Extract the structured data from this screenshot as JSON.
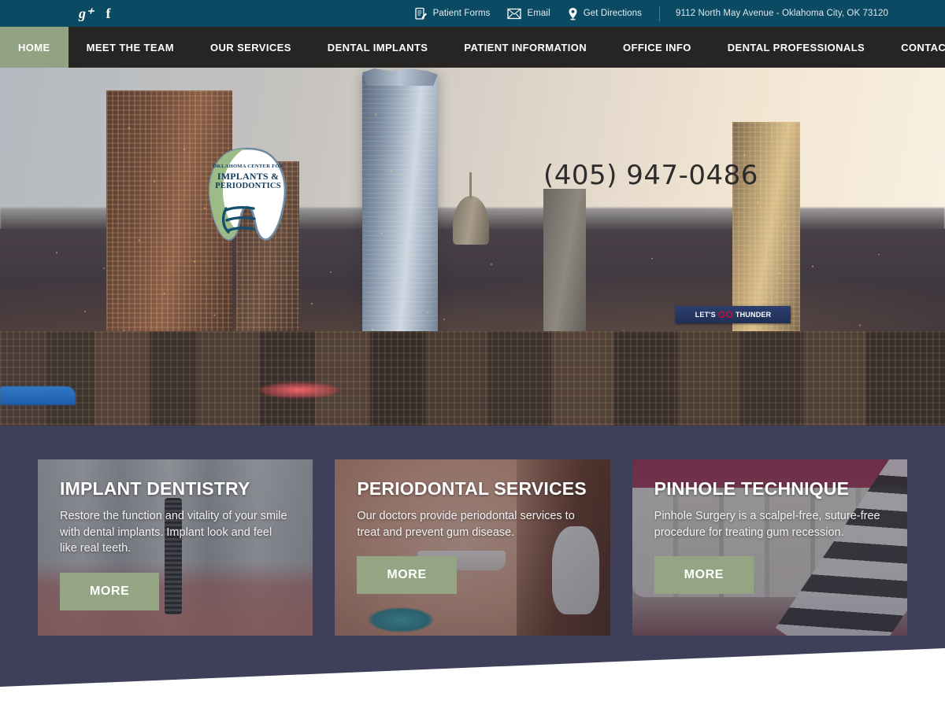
{
  "topbar": {
    "social": [
      {
        "name": "google-plus-icon",
        "glyph": "g⁺"
      },
      {
        "name": "facebook-icon",
        "glyph": "f"
      }
    ],
    "links": [
      {
        "label": "Patient Forms",
        "icon": "patient-forms-icon"
      },
      {
        "label": "Email",
        "icon": "envelope-icon"
      },
      {
        "label": "Get Directions",
        "icon": "map-pin-icon"
      }
    ],
    "address": "9112 North May Avenue - Oklahoma City, OK 73120",
    "bg_color": "#0b4a63"
  },
  "nav": {
    "items": [
      {
        "label": "HOME",
        "active": true
      },
      {
        "label": "MEET THE TEAM",
        "active": false
      },
      {
        "label": "OUR SERVICES",
        "active": false
      },
      {
        "label": "DENTAL IMPLANTS",
        "active": false
      },
      {
        "label": "PATIENT INFORMATION",
        "active": false
      },
      {
        "label": "OFFICE INFO",
        "active": false
      },
      {
        "label": "DENTAL PROFESSIONALS",
        "active": false
      },
      {
        "label": "CONTACT US",
        "active": false
      }
    ],
    "bg_color": "#272523",
    "active_color": "#92a383"
  },
  "hero": {
    "logo": {
      "line1": "OKLAHOMA CENTER FOR",
      "line2": "IMPLANTS &",
      "line3": "PERIODONTICS"
    },
    "phone": "(405) 947-0486",
    "billboard": {
      "pre": "LET'S",
      "accent": "GO",
      "post": "THUNDER"
    }
  },
  "band": {
    "bg_color": "#3e4059"
  },
  "cards": [
    {
      "title": "IMPLANT DENTISTRY",
      "description": "Restore the function and vitality of your smile with dental implants.  Implant look and feel like real teeth.",
      "button": "MORE",
      "image": "dental-implant-photo"
    },
    {
      "title": "PERIODONTAL SERVICES",
      "description": "Our doctors  provide periodontal services to treat and prevent gum disease.",
      "button": "MORE",
      "image": "smiling-patient-photo"
    },
    {
      "title": "PINHOLE TECHNIQUE",
      "description": "Pinhole Surgery is a scalpel-free, suture-free procedure for treating gum recession.",
      "button": "MORE",
      "image": "gum-recession-photo"
    }
  ],
  "colors": {
    "teal": "#0b4a63",
    "charcoal": "#272523",
    "sage": "#93a583",
    "navy": "#3e4059"
  }
}
